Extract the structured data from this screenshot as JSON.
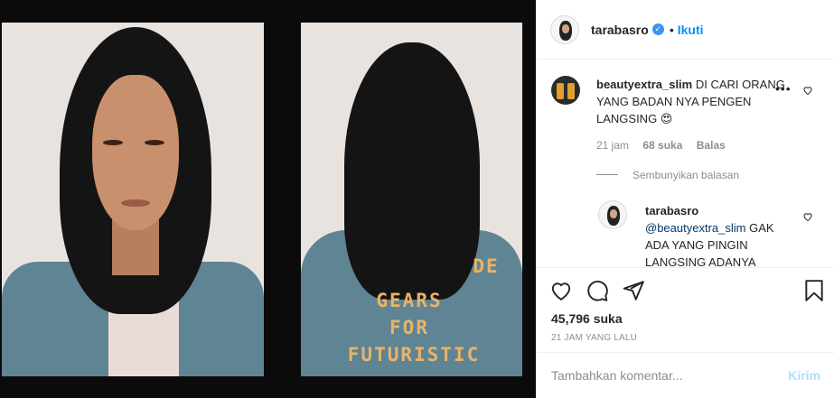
{
  "post": {
    "username": "tarabasro",
    "separator": "•",
    "follow_label": "Ikuti",
    "image_text": [
      "GEARS",
      "FOR",
      "FUTURISTIC"
    ],
    "image_partial_text": "DE"
  },
  "comments": [
    {
      "username": "beautyextra_slim",
      "text": "DI CARI ORANG YANG BADAN NYA PENGEN LANGSING 😍",
      "time": "21 jam",
      "likes": "68 suka",
      "reply_label": "Balas",
      "more": "•••",
      "hide_replies_label": "Sembunyikan balasan"
    }
  ],
  "reply": {
    "username": "tarabasro",
    "mention": "@beautyextra_slim",
    "text": " GAK ADA YANG PINGIN LANGSING ADANYA"
  },
  "likes_count": "45,796 suka",
  "posted_ago": "21 JAM YANG LALU",
  "comment_box": {
    "placeholder": "Tambahkan komentar...",
    "post_label": "Kirim"
  },
  "colors": {
    "accent": "#0095f6",
    "verified": "#3897f0",
    "post_disabled": "#b2dffc",
    "muted": "#8e8e8e"
  },
  "icons": [
    "verified-badge-icon",
    "more-options-icon",
    "heart-icon",
    "comment-icon",
    "share-icon",
    "bookmark-icon"
  ]
}
